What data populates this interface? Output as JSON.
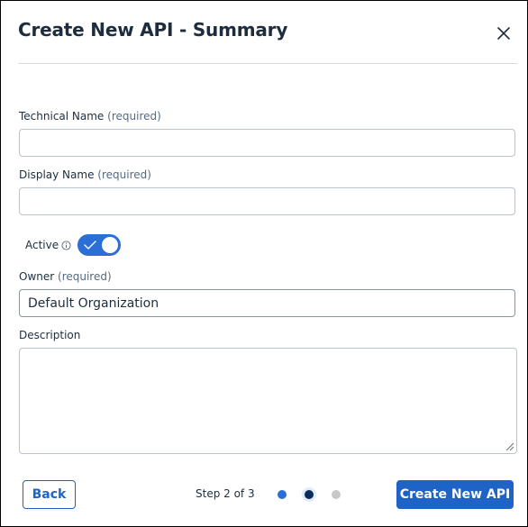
{
  "dialog": {
    "title": "Create New API - Summary",
    "close_icon": "close-icon"
  },
  "form": {
    "technical_name": {
      "label": "Technical Name",
      "required_hint": "(required)",
      "value": ""
    },
    "display_name": {
      "label": "Display Name",
      "required_hint": "(required)",
      "value": ""
    },
    "active": {
      "label": "Active",
      "info_icon": "info-icon",
      "enabled": true
    },
    "owner": {
      "label": "Owner",
      "required_hint": "(required)",
      "value": "Default Organization"
    },
    "description": {
      "label": "Description",
      "value": ""
    }
  },
  "footer": {
    "back_label": "Back",
    "step_text": "Step 2 of 3",
    "current_step": 2,
    "total_steps": 3,
    "create_label": "Create New API"
  },
  "colors": {
    "primary": "#1f63c7",
    "active_dot": "#0b2c5a",
    "inactive_dot": "#c8c8c8"
  }
}
